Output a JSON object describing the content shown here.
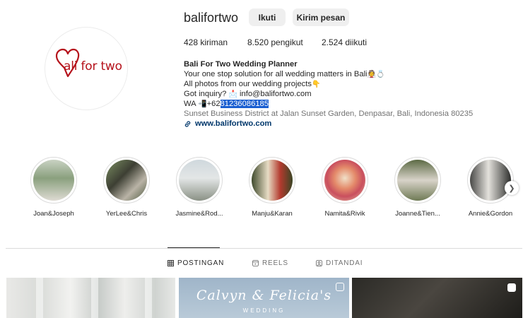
{
  "profile": {
    "username": "balifortwo",
    "logo_text": "ali for two",
    "follow_label": "Ikuti",
    "message_label": "Kirim pesan",
    "stats": [
      {
        "value": "428",
        "label": "kiriman"
      },
      {
        "value": "8.520",
        "label": "pengikut"
      },
      {
        "value": "2.524",
        "label": "diikuti"
      }
    ],
    "bio": {
      "name": "Bali For Two Wedding Planner",
      "line1": "Your one stop solution for all wedding matters in Bali",
      "line2": "All photos from our wedding projects",
      "line3_prefix": "Got inquiry?",
      "email": "info@balifortwo.com",
      "wa_prefix": "WA",
      "phone_prefix": "+62",
      "phone_selected": "81236086185",
      "address": "Sunset Business District at Jalan Sunset Garden, Denpasar, Bali, Indonesia 80235",
      "website": "www.balifortwo.com"
    }
  },
  "highlights": [
    {
      "label": "Joan&Joseph"
    },
    {
      "label": "YerLee&Chris"
    },
    {
      "label": "Jasmine&Rod..."
    },
    {
      "label": "Manju&Karan"
    },
    {
      "label": "Namita&Rivik"
    },
    {
      "label": "Joanne&Tien..."
    },
    {
      "label": "Annie&Gordon"
    }
  ],
  "tabs": [
    {
      "label": "POSTINGAN",
      "icon": "grid-icon",
      "active": true
    },
    {
      "label": "REELS",
      "icon": "reels-icon",
      "active": false
    },
    {
      "label": "DITANDAI",
      "icon": "tagged-icon",
      "active": false
    }
  ],
  "posts": [
    {
      "kind": "photo"
    },
    {
      "kind": "reel",
      "title": "Calvyn & Felicia's",
      "subtitle": "WEDDING"
    },
    {
      "kind": "carousel"
    }
  ],
  "colors": {
    "brand_red": "#b5121b",
    "link": "#00376b",
    "selection": "#1a5fd1"
  }
}
